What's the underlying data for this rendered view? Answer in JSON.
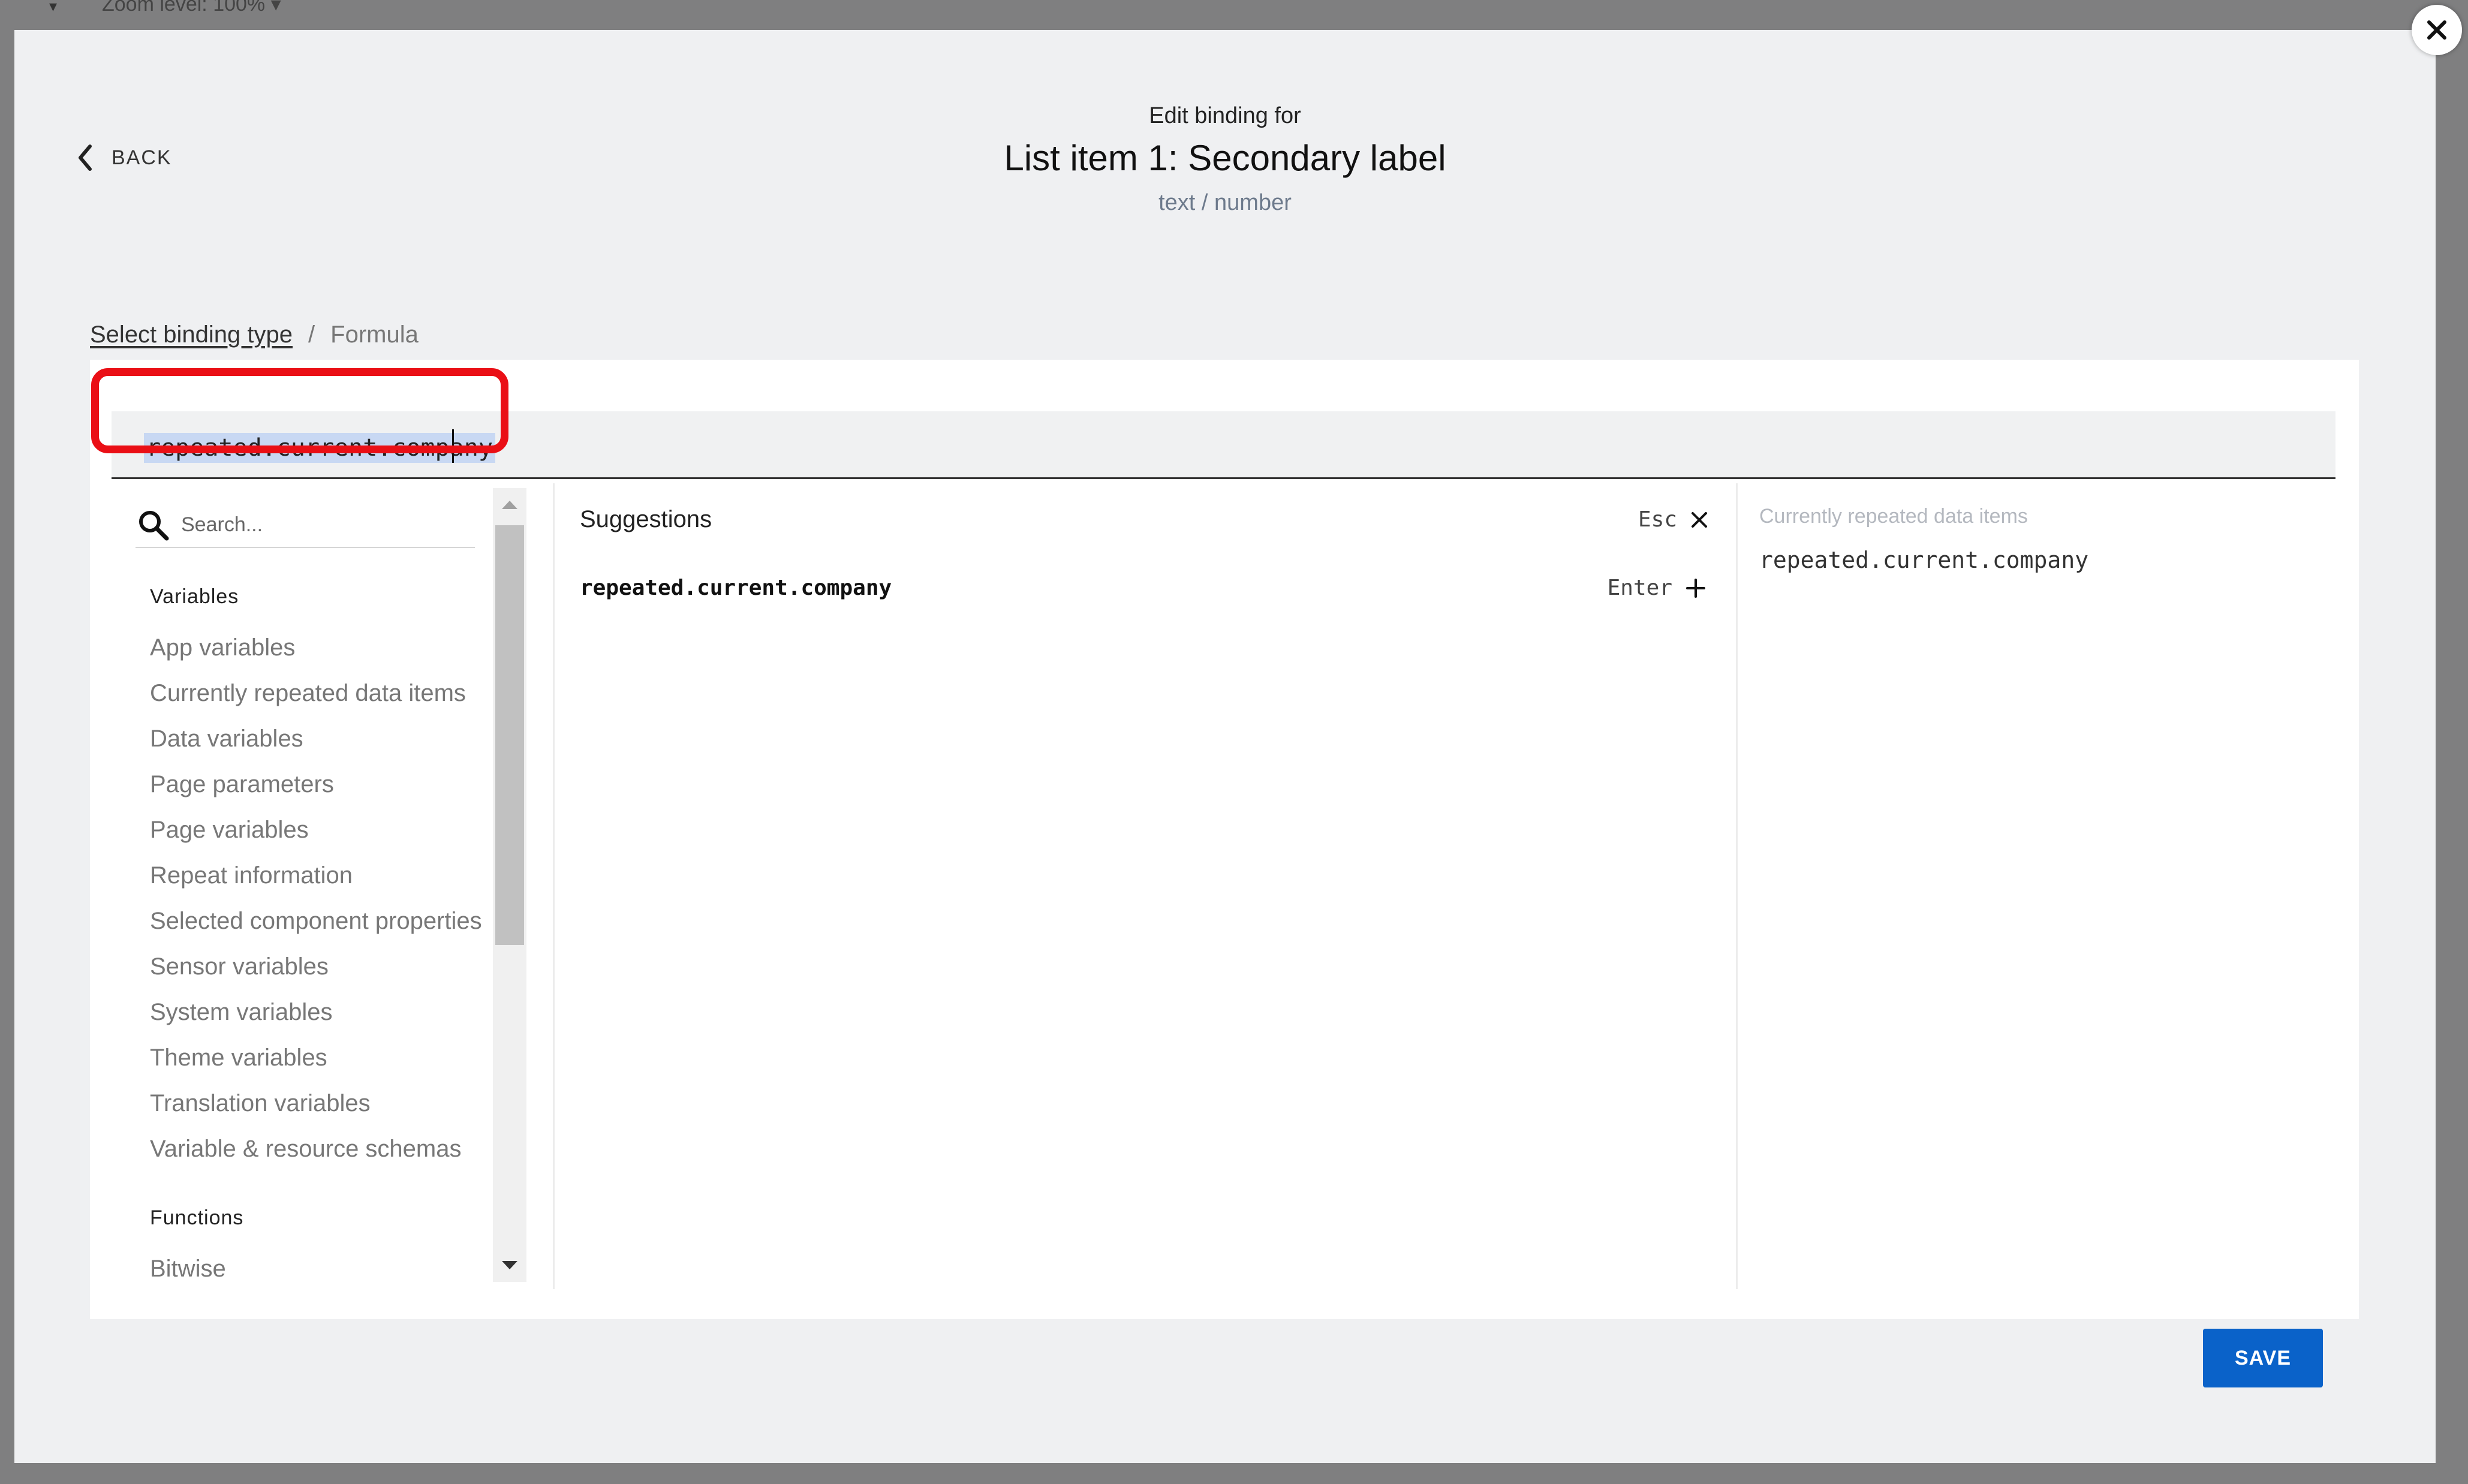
{
  "background_toolbar": {
    "caret": "▾",
    "zoom_label": "Zoom level:",
    "zoom_value": "100%",
    "zoom_caret": "▾"
  },
  "modal": {
    "back_label": "BACK",
    "header_pre": "Edit binding for",
    "header_title": "List item 1: Secondary label",
    "header_subtitle": "text / number",
    "close_icon": "close-icon"
  },
  "breadcrumb": {
    "link": "Select binding type",
    "separator": "/",
    "current": "Formula"
  },
  "formula": {
    "value": "repeated.current.company",
    "highlight_color": "#ea0f16"
  },
  "categories": {
    "search_placeholder": "Search...",
    "variables_heading": "Variables",
    "variables": [
      "App variables",
      "Currently repeated data items",
      "Data variables",
      "Page parameters",
      "Page variables",
      "Repeat information",
      "Selected component properties",
      "Sensor variables",
      "System variables",
      "Theme variables",
      "Translation variables",
      "Variable & resource schemas"
    ],
    "functions_heading": "Functions",
    "functions": [
      "Bitwise"
    ]
  },
  "suggestions": {
    "title": "Suggestions",
    "esc_label": "Esc",
    "items": [
      {
        "value": "repeated.current.company",
        "key_hint": "Enter"
      }
    ]
  },
  "preview": {
    "title": "Currently repeated data items",
    "value": "repeated.current.company"
  },
  "actions": {
    "save_label": "SAVE",
    "save_color": "#0a62c9"
  }
}
